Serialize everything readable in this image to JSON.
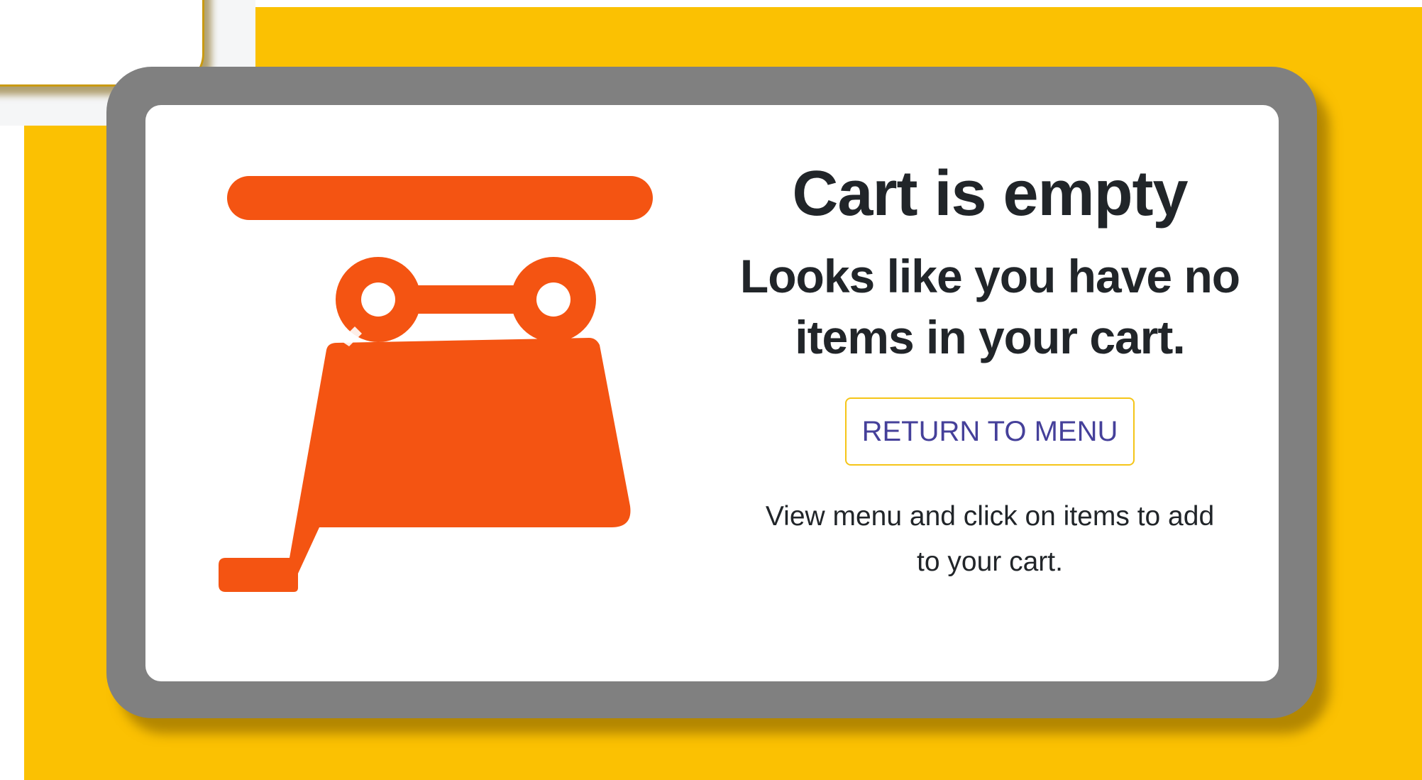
{
  "empty_cart": {
    "title": "Cart is empty",
    "subtitle": "Looks like you have no items in your cart.",
    "return_button_label": "RETURN TO MENU",
    "hint": "View menu and click on items to add to your cart."
  },
  "icons": {
    "illustration": "shopping-cart-icon"
  },
  "colors": {
    "background_accent": "#fbc102",
    "card_frame": "#808080",
    "illustration": "#f45412",
    "button_border": "#f5c518",
    "button_text": "#45409a",
    "text": "#212529"
  }
}
